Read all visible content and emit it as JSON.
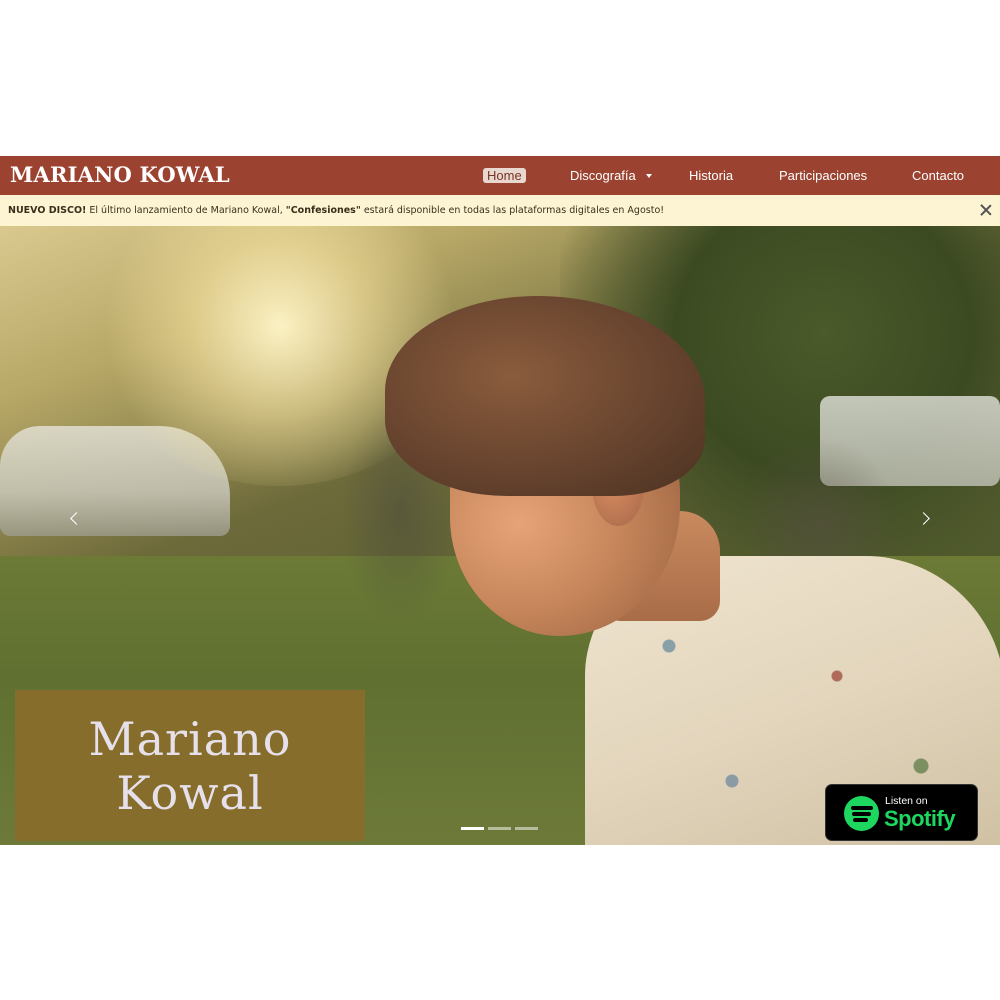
{
  "brand": "MARIANO KOWAL",
  "nav": {
    "items": [
      {
        "label": "Home",
        "active": true
      },
      {
        "label": "Discografía",
        "dropdown": true
      },
      {
        "label": "Historia"
      },
      {
        "label": "Participaciones"
      },
      {
        "label": "Contacto"
      }
    ]
  },
  "alert": {
    "prefix": "NUEVO DISCO!",
    "text_before": " El último lanzamiento de Mariano Kowal, ",
    "album": "\"Confesiones\"",
    "text_after": " estará disponible en todas las plataformas digitales en Agosto!"
  },
  "hero": {
    "title_line1": "Mariano",
    "title_line2": "Kowal",
    "slides": 3,
    "active_slide": 1
  },
  "spotify": {
    "listen_label": "Listen on",
    "brand_label": "Spotify",
    "color": "#1ed760"
  },
  "colors": {
    "navbar": "#9b4330",
    "alert_bg": "#fdf4d3",
    "title_box": "#866d2c"
  }
}
